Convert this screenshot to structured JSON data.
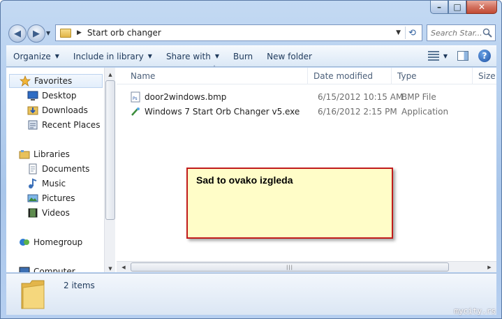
{
  "window": {
    "caption": {
      "minimize": "–",
      "maximize": "□",
      "close": "✕"
    }
  },
  "address_bar": {
    "path": "Start orb changer",
    "separator": "▶"
  },
  "search": {
    "placeholder": "Search Star..."
  },
  "toolbar": {
    "items": [
      {
        "label": "Organize",
        "has_dropdown": true
      },
      {
        "label": "Include in library",
        "has_dropdown": true
      },
      {
        "label": "Share with",
        "has_dropdown": true
      },
      {
        "label": "Burn",
        "has_dropdown": false
      },
      {
        "label": "New folder",
        "has_dropdown": false
      }
    ]
  },
  "nav_pane": {
    "favorites": {
      "label": "Favorites",
      "items": [
        "Desktop",
        "Downloads",
        "Recent Places"
      ]
    },
    "libraries": {
      "label": "Libraries",
      "items": [
        "Documents",
        "Music",
        "Pictures",
        "Videos"
      ]
    },
    "homegroup": "Homegroup",
    "computer": "Computer"
  },
  "columns": [
    "Name",
    "Date modified",
    "Type",
    "Size"
  ],
  "files": [
    {
      "name": "door2windows.bmp",
      "date": "6/15/2012 10:15 AM",
      "type": "BMP File",
      "icon": "bmp-file-icon"
    },
    {
      "name": "Windows 7 Start Orb Changer v5.exe",
      "date": "6/16/2012 2:15 PM",
      "type": "Application",
      "icon": "exe-file-icon"
    }
  ],
  "annotation": {
    "text": "Sad to ovako izgleda",
    "border_color": "#c11b1b",
    "fill_color": "#fffdc8"
  },
  "details": {
    "item_count": "2 items"
  },
  "watermark": "mycity.rs"
}
